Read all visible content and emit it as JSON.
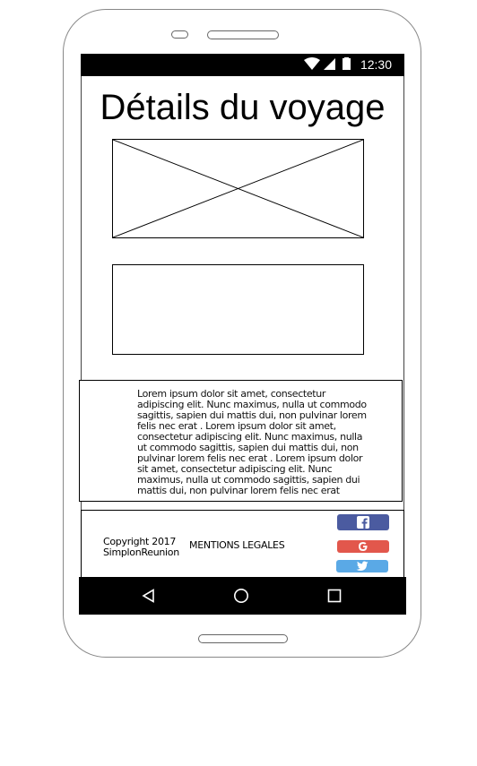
{
  "status_bar": {
    "time": "12:30",
    "icons": [
      "wifi-icon",
      "signal-icon",
      "battery-icon"
    ]
  },
  "page": {
    "title": "Détails du voyage"
  },
  "content": {
    "image_placeholder": "image-placeholder",
    "description": "Lorem ipsum dolor sit amet, consectetur adipiscing elit. Nunc maximus, nulla ut commodo sagittis, sapien dui mattis dui, non pulvinar lorem felis nec erat . Lorem ipsum dolor sit amet, consectetur adipiscing elit. Nunc maximus, nulla ut commodo sagittis, sapien dui mattis dui, non pulvinar lorem felis nec erat . Lorem ipsum dolor sit amet, consectetur adipiscing elit. Nunc maximus, nulla ut commodo sagittis, sapien dui mattis dui, non pulvinar lorem felis nec erat"
  },
  "footer": {
    "copyright_line1": "Copyright 2017",
    "copyright_line2": "SimplonReunion",
    "mentions": "MENTIONS LEGALES",
    "social": [
      {
        "name": "facebook-icon",
        "color": "#4b5ba0"
      },
      {
        "name": "google-icon",
        "color": "#e2574c"
      },
      {
        "name": "twitter-icon",
        "color": "#5aa9e6"
      }
    ]
  },
  "nav_bar": {
    "buttons": [
      "back-icon",
      "home-icon",
      "recents-icon"
    ]
  }
}
